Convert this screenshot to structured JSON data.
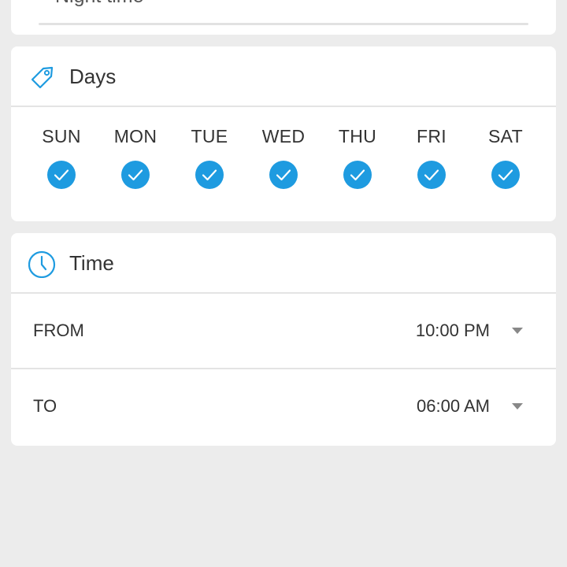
{
  "name_section": {
    "value": "Night time"
  },
  "days_section": {
    "title": "Days",
    "icon": "tag-icon",
    "days": [
      {
        "label": "SUN",
        "checked": true
      },
      {
        "label": "MON",
        "checked": true
      },
      {
        "label": "TUE",
        "checked": true
      },
      {
        "label": "WED",
        "checked": true
      },
      {
        "label": "THU",
        "checked": true
      },
      {
        "label": "FRI",
        "checked": true
      },
      {
        "label": "SAT",
        "checked": true
      }
    ]
  },
  "time_section": {
    "title": "Time",
    "icon": "clock-icon",
    "from": {
      "label": "FROM",
      "value": "10:00 PM"
    },
    "to": {
      "label": "TO",
      "value": "06:00 AM"
    }
  },
  "colors": {
    "accent": "#1e9be0",
    "background": "#ececec",
    "card": "#ffffff"
  }
}
